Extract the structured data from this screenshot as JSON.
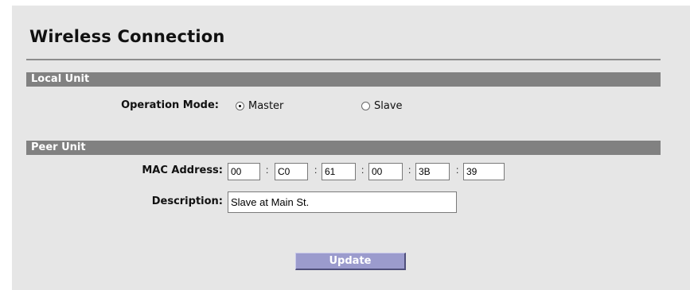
{
  "page": {
    "title": "Wireless Connection"
  },
  "local_unit": {
    "heading": "Local Unit",
    "operation_mode_label": "Operation Mode:",
    "options": [
      {
        "label": "Master",
        "checked": true
      },
      {
        "label": "Slave",
        "checked": false
      }
    ]
  },
  "peer_unit": {
    "heading": "Peer Unit",
    "mac_label": "MAC Address:",
    "mac_octets": [
      "00",
      "C0",
      "61",
      "00",
      "3B",
      "39"
    ],
    "mac_separator": ":",
    "description_label": "Description:",
    "description_value": "Slave at Main St."
  },
  "actions": {
    "update_label": "Update"
  },
  "colors": {
    "panel_bg": "#e6e6e6",
    "section_bar": "#818181",
    "button_bg": "#9b9bcd"
  }
}
